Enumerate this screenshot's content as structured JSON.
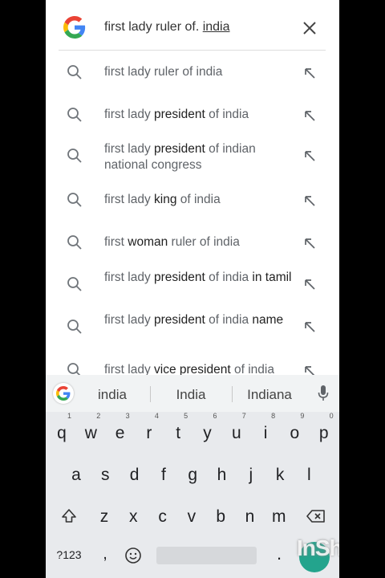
{
  "search": {
    "query_prefix": "first lady ruler of. ",
    "query_underlined": "india"
  },
  "suggestions": [
    {
      "parts": [
        {
          "t": "first lady ruler of india",
          "b": false
        }
      ]
    },
    {
      "parts": [
        {
          "t": "first lady ",
          "b": false
        },
        {
          "t": "president",
          "b": true
        },
        {
          "t": " of india",
          "b": false
        }
      ]
    },
    {
      "parts": [
        {
          "t": "first lady ",
          "b": false
        },
        {
          "t": "president",
          "b": true
        },
        {
          "t": " of indian national congress",
          "b": false
        }
      ]
    },
    {
      "parts": [
        {
          "t": "first lady ",
          "b": false
        },
        {
          "t": "king",
          "b": true
        },
        {
          "t": " of india",
          "b": false
        }
      ]
    },
    {
      "parts": [
        {
          "t": "first ",
          "b": false
        },
        {
          "t": "woman",
          "b": true
        },
        {
          "t": " ruler of india",
          "b": false
        }
      ]
    },
    {
      "parts": [
        {
          "t": "first lady ",
          "b": false
        },
        {
          "t": "president",
          "b": true
        },
        {
          "t": " of india ",
          "b": false
        },
        {
          "t": "in tamil",
          "b": true
        }
      ]
    },
    {
      "parts": [
        {
          "t": "first lady ",
          "b": false
        },
        {
          "t": "president",
          "b": true
        },
        {
          "t": " of india ",
          "b": false
        },
        {
          "t": "name",
          "b": true
        }
      ]
    },
    {
      "parts": [
        {
          "t": "first lady ",
          "b": false
        },
        {
          "t": "vice president",
          "b": true
        },
        {
          "t": " of india",
          "b": false
        }
      ]
    }
  ],
  "keyboard": {
    "candidates": [
      "india",
      "India",
      "Indiana"
    ],
    "row1": [
      {
        "k": "q",
        "h": "1"
      },
      {
        "k": "w",
        "h": "2"
      },
      {
        "k": "e",
        "h": "3"
      },
      {
        "k": "r",
        "h": "4"
      },
      {
        "k": "t",
        "h": "5"
      },
      {
        "k": "y",
        "h": "6"
      },
      {
        "k": "u",
        "h": "7"
      },
      {
        "k": "i",
        "h": "8"
      },
      {
        "k": "o",
        "h": "9"
      },
      {
        "k": "p",
        "h": "0"
      }
    ],
    "row2": [
      "a",
      "s",
      "d",
      "f",
      "g",
      "h",
      "j",
      "k",
      "l"
    ],
    "row3": [
      "z",
      "x",
      "c",
      "v",
      "b",
      "n",
      "m"
    ],
    "symbols_label": "?123",
    "comma": ",",
    "period": "."
  },
  "watermark": "InShOt",
  "colors": {
    "accent": "#23a48d",
    "google_blue": "#4285f4",
    "google_red": "#ea4335",
    "google_yellow": "#fbbc05",
    "google_green": "#34a853"
  }
}
